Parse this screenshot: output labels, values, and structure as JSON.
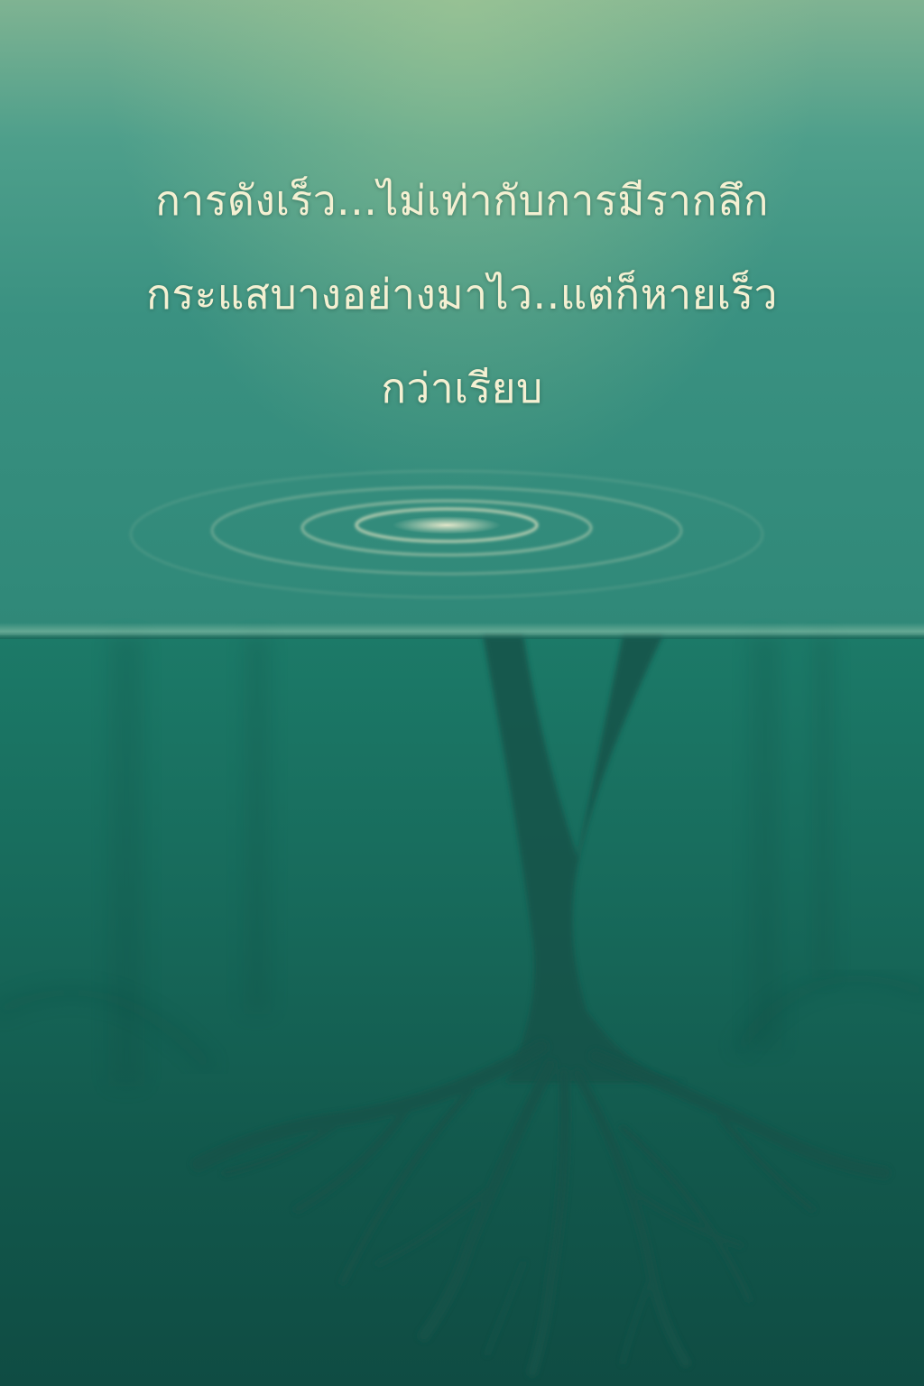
{
  "quote": {
    "line1": "การดังเร็ว...ไม่เท่ากับการมีรากลึก",
    "line2": "กระแสบางอย่างมาไว..แต่ก็หายเร็ว",
    "line3": "กว่าเรียบ"
  },
  "colors": {
    "text": "#f4f0d2",
    "sky_top": "#8fb792",
    "water": "#1c7a68",
    "tree": "#14514a"
  }
}
